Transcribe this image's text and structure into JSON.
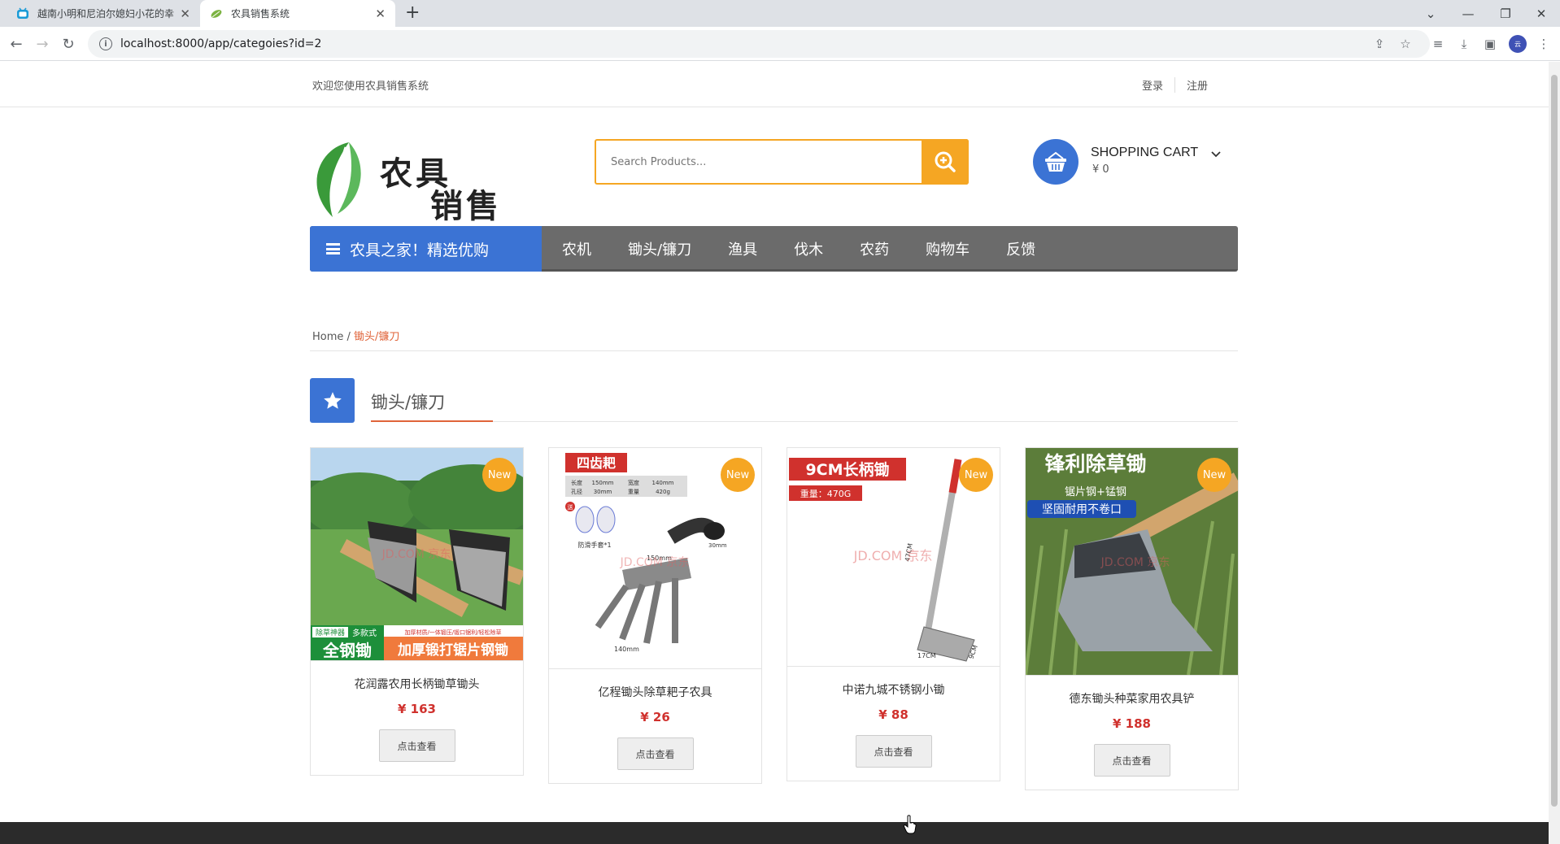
{
  "browser": {
    "tabs": [
      {
        "title": "越南小明和尼泊尔媳妇小花的幸",
        "active": false
      },
      {
        "title": "农具销售系统",
        "active": true
      }
    ],
    "url": "localhost:8000/app/categoies?id=2"
  },
  "topbar": {
    "welcome": "欢迎您使用农具销售系统",
    "login": "登录",
    "register": "注册"
  },
  "logo": {
    "line1": "农具",
    "line2": "销售"
  },
  "search": {
    "placeholder": "Search Products..."
  },
  "cart": {
    "title": "SHOPPING CART",
    "total": "¥ 0"
  },
  "nav": {
    "category_label": "农具之家！精选优购",
    "items": [
      "农机",
      "锄头/镰刀",
      "渔具",
      "伐木",
      "农药",
      "购物车",
      "反馈"
    ]
  },
  "breadcrumb": {
    "home": "Home",
    "separator": " / ",
    "current": "锄头/镰刀"
  },
  "section": {
    "title": "锄头/镰刀"
  },
  "products": [
    {
      "name": "花润露农用长柄锄草锄头",
      "price": "¥ 163",
      "badge": "New",
      "button": "点击查看"
    },
    {
      "name": "亿程锄头除草耙子农具",
      "price": "¥ 26",
      "badge": "New",
      "button": "点击查看"
    },
    {
      "name": "中诺九城不锈钢小锄",
      "price": "¥ 88",
      "badge": "New",
      "button": "点击查看"
    },
    {
      "name": "德东锄头种菜家用农具铲",
      "price": "¥ 188",
      "badge": "New",
      "button": "点击查看"
    }
  ],
  "product_images": {
    "p1": {
      "tag_left": "除草神器",
      "tag_mid": "多款式",
      "tag_right": "加厚材质/一体锻压/锻口锯利/轻松除草",
      "big_left": "全钢锄",
      "big_right": "加厚锻打锯片钢锄",
      "watermark": "JD.COM 京东"
    },
    "p2": {
      "head": "四齿耙",
      "spec1a": "长度",
      "spec1b": "150mm",
      "spec1c": "宽度",
      "spec1d": "140mm",
      "spec2a": "孔径",
      "spec2b": "30mm",
      "spec2c": "重量",
      "spec2d": "420g",
      "gift": "送",
      "glove": "防滑手套*1",
      "dim1": "150mm",
      "dim2": "140mm",
      "dim3": "30mm",
      "watermark": "JD.COM 京东"
    },
    "p3": {
      "head": "9CM长柄锄",
      "weight": "重量：470G",
      "dim1": "47CM",
      "dim2": "17CM",
      "dim3": "9CM",
      "watermark": "JD.COM 京东"
    },
    "p4": {
      "head": "锋利除草锄",
      "sub1": "锯片钢+锰钢",
      "sub2": "坚固耐用不卷口",
      "watermark": "JD.COM 京东"
    }
  },
  "colors": {
    "accent_blue": "#3b73d4",
    "accent_orange": "#f5a623",
    "price_red": "#d0312d",
    "breadcrumb_current": "#e0643a"
  }
}
